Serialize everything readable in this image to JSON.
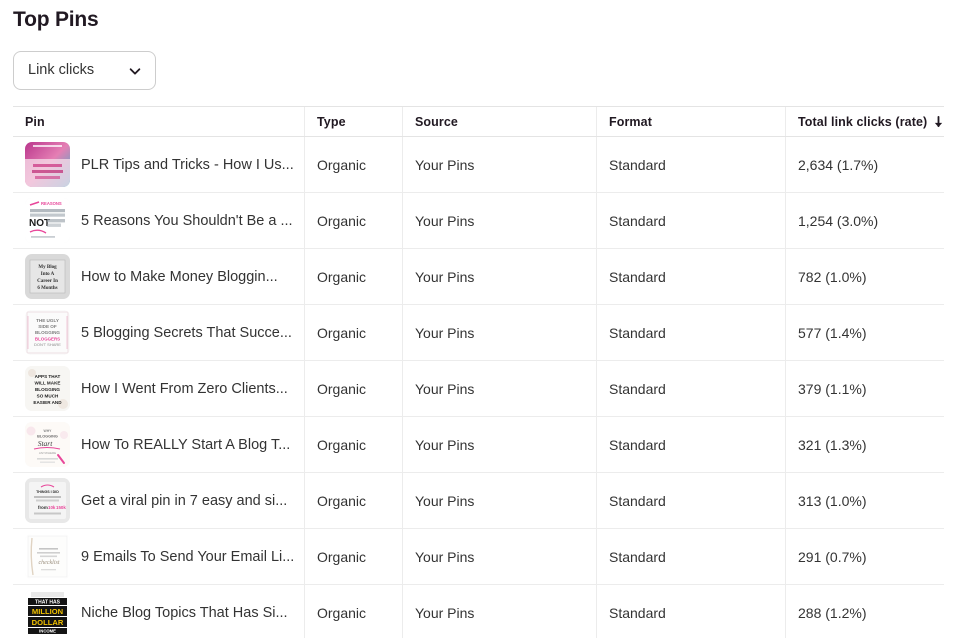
{
  "header": {
    "title": "Top Pins"
  },
  "metric_select": {
    "value": "Link clicks",
    "icon": "chevron-down-icon"
  },
  "table": {
    "columns": [
      {
        "key": "pin",
        "label": "Pin"
      },
      {
        "key": "type",
        "label": "Type"
      },
      {
        "key": "source",
        "label": "Source"
      },
      {
        "key": "format",
        "label": "Format"
      },
      {
        "key": "clicks",
        "label": "Total link clicks (rate)"
      }
    ],
    "sort": {
      "column": "Total link clicks (rate)",
      "direction": "descending",
      "icon": "arrow-down-icon"
    },
    "rows": [
      {
        "title": "PLR Tips and Tricks - How I Us...",
        "type": "Organic",
        "source": "Your Pins",
        "format": "Standard",
        "clicks": "2,634 (1.7%)",
        "thumb": "plr-tips-thumbnail"
      },
      {
        "title": "5 Reasons You Shouldn't Be a ...",
        "type": "Organic",
        "source": "Your Pins",
        "format": "Standard",
        "clicks": "1,254 (3.0%)",
        "thumb": "five-reasons-thumbnail"
      },
      {
        "title": "How to Make Money Bloggin...",
        "type": "Organic",
        "source": "Your Pins",
        "format": "Standard",
        "clicks": "782 (1.0%)",
        "thumb": "make-money-blogging-thumbnail"
      },
      {
        "title": "5 Blogging Secrets That Succe...",
        "type": "Organic",
        "source": "Your Pins",
        "format": "Standard",
        "clicks": "577 (1.4%)",
        "thumb": "blogging-secrets-thumbnail"
      },
      {
        "title": "How I Went From Zero Clients...",
        "type": "Organic",
        "source": "Your Pins",
        "format": "Standard",
        "clicks": "379 (1.1%)",
        "thumb": "zero-clients-thumbnail"
      },
      {
        "title": "How To REALLY Start A Blog T...",
        "type": "Organic",
        "source": "Your Pins",
        "format": "Standard",
        "clicks": "321 (1.3%)",
        "thumb": "start-a-blog-thumbnail"
      },
      {
        "title": "Get a viral pin in 7 easy and si...",
        "type": "Organic",
        "source": "Your Pins",
        "format": "Standard",
        "clicks": "313 (1.0%)",
        "thumb": "viral-pin-thumbnail"
      },
      {
        "title": "9 Emails To Send Your Email Li...",
        "type": "Organic",
        "source": "Your Pins",
        "format": "Standard",
        "clicks": "291 (0.7%)",
        "thumb": "nine-emails-thumbnail"
      },
      {
        "title": "Niche Blog Topics That Has Si...",
        "type": "Organic",
        "source": "Your Pins",
        "format": "Standard",
        "clicks": "288 (1.2%)",
        "thumb": "niche-blog-topics-thumbnail"
      }
    ]
  },
  "colors": {
    "text": "#333333",
    "heading": "#211922",
    "border": "#ececec",
    "border_strong": "#e4e4e4",
    "accent_pink": "#e8479a",
    "accent_teal": "#2fb8c8",
    "accent_yellow": "#f2c200"
  }
}
